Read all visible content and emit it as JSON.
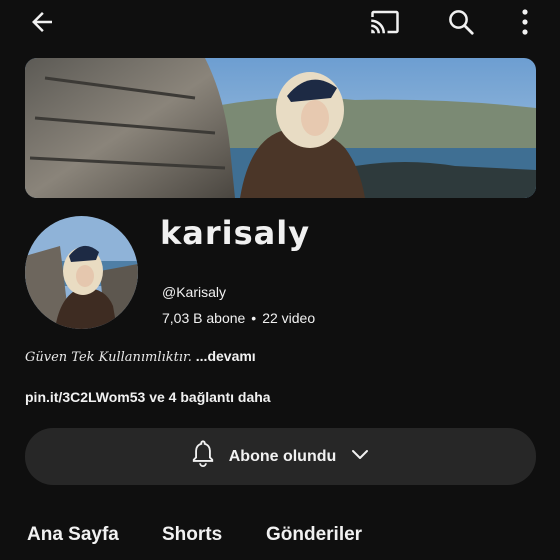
{
  "header": {
    "back_icon": "arrow-left-icon",
    "cast_icon": "cast-icon",
    "search_icon": "search-icon",
    "more_icon": "more-vertical-icon"
  },
  "channel": {
    "name": "karisaly",
    "handle": "@Karisaly",
    "subscribers": "7,03 B abone",
    "separator": "•",
    "videos": "22 video"
  },
  "description": {
    "text": "Güven Tek Kullanımlıktır.",
    "more": "...devamı"
  },
  "links": {
    "url": "pin.it/3C2LWom53",
    "extra": "ve 4 bağlantı daha"
  },
  "subscribe": {
    "label": "Abone olundu",
    "bell_icon": "bell-icon",
    "chevron_icon": "chevron-down-icon"
  },
  "tabs": [
    {
      "label": "Ana Sayfa"
    },
    {
      "label": "Shorts"
    },
    {
      "label": "Gönderiler"
    }
  ],
  "colors": {
    "background": "#0f0f0f",
    "button_bg": "#272727",
    "text": "#f1f1f1"
  }
}
